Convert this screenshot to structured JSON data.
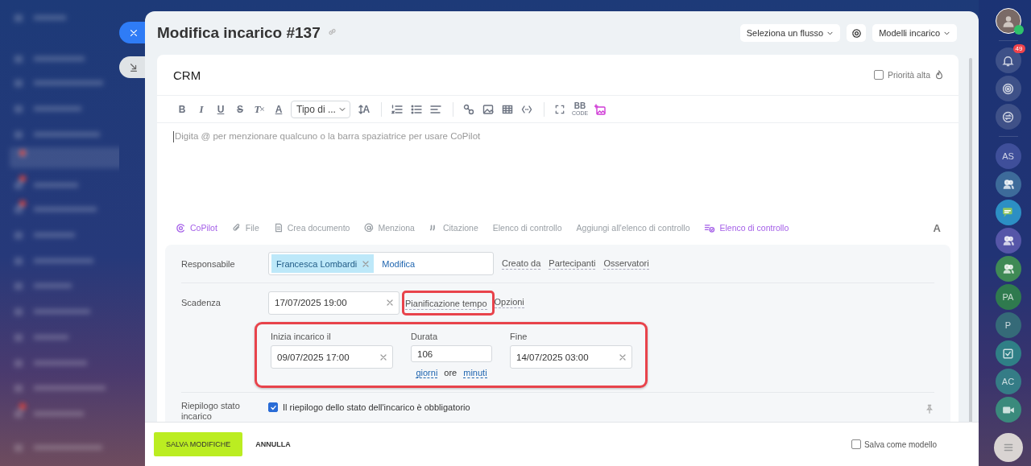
{
  "header": {
    "title": "Modifica incarico #137",
    "flow_select": "Seleziona un flusso",
    "templates_select": "Modelli incarico"
  },
  "task": {
    "title": "CRM",
    "high_priority": {
      "label": "Priorità alta",
      "checked": false
    }
  },
  "toolbar": {
    "items": [
      {
        "kind": "bold",
        "glyph": "B"
      },
      {
        "kind": "italic",
        "glyph": "I"
      },
      {
        "kind": "underline",
        "glyph": "U"
      },
      {
        "kind": "strike",
        "glyph": "S"
      },
      {
        "kind": "clear",
        "glyph": "T"
      },
      {
        "kind": "color",
        "glyph": "A"
      },
      {
        "kind": "select",
        "label": "Tipo di ..."
      },
      {
        "kind": "size",
        "glyph": "A"
      },
      {
        "kind": "sep"
      },
      {
        "kind": "ordered-list"
      },
      {
        "kind": "bullet-list"
      },
      {
        "kind": "align"
      },
      {
        "kind": "sep"
      },
      {
        "kind": "link"
      },
      {
        "kind": "image"
      },
      {
        "kind": "table"
      },
      {
        "kind": "code"
      },
      {
        "kind": "sep"
      },
      {
        "kind": "fullscreen"
      },
      {
        "kind": "bbcode",
        "glyph": "BB",
        "sub": "CODE"
      },
      {
        "kind": "ai-image"
      }
    ]
  },
  "editor": {
    "placeholder": "Digita @ per menzionare qualcuno o la barra spaziatrice per usare CoPilot"
  },
  "actions": {
    "items": [
      {
        "kind": "copilot",
        "label": "CoPilot"
      },
      {
        "kind": "file",
        "label": "File"
      },
      {
        "kind": "document",
        "label": "Crea documento"
      },
      {
        "kind": "mention",
        "label": "Menziona"
      },
      {
        "kind": "quote",
        "label": "Citazione"
      },
      {
        "kind": "plain",
        "label": "Elenco di controllo"
      },
      {
        "kind": "plain",
        "label": "Aggiungi all'elenco di controllo"
      },
      {
        "kind": "checklist",
        "label": "Elenco di controllo"
      }
    ],
    "format_toggle": "A"
  },
  "form": {
    "responsible": {
      "label": "Responsabile",
      "person": "Francesca Lombardi",
      "change_link": "Modifica",
      "role_links": [
        "Creato da",
        "Partecipanti",
        "Osservatori"
      ]
    },
    "deadline": {
      "label": "Scadenza",
      "value": "17/07/2025 19:00",
      "planning_link": "Pianificazione tempo",
      "options_link": "Opzioni"
    },
    "planning": {
      "start": {
        "label": "Inizia incarico il",
        "value": "09/07/2025 17:00"
      },
      "duration": {
        "label": "Durata",
        "value": "106"
      },
      "end": {
        "label": "Fine",
        "value": "14/07/2025 03:00"
      },
      "units": [
        {
          "label": "giorni",
          "selected": false
        },
        {
          "label": "ore",
          "selected": true
        },
        {
          "label": "minuti",
          "selected": false
        }
      ]
    },
    "summary": {
      "label": "Riepilogo stato incarico",
      "checkbox_label": "Il riepilogo dello stato dell'incarico è obbligatorio",
      "checked": true
    }
  },
  "footer": {
    "save": "SALVA MODIFICHE",
    "cancel": "ANNULLA",
    "save_template": {
      "label": "Salva come modello",
      "checked": false
    }
  },
  "right_bar": {
    "notifications": "49",
    "apps": [
      {
        "kind": "initials",
        "initials": "AS",
        "color": "#3f4f9a"
      },
      {
        "kind": "group",
        "color": "#3d6b9a"
      },
      {
        "kind": "chat",
        "color": "#2c8fc4"
      },
      {
        "kind": "group",
        "color": "#5656a8"
      },
      {
        "kind": "group",
        "color": "#3f8a55"
      },
      {
        "kind": "initials",
        "initials": "PA",
        "color": "#2f7a4e"
      },
      {
        "kind": "initials",
        "initials": "P",
        "color": "#356a78"
      },
      {
        "kind": "task",
        "color": "#2f7f86"
      },
      {
        "kind": "initials",
        "initials": "AC",
        "color": "#357c86"
      },
      {
        "kind": "video",
        "color": "#3a8a7c"
      }
    ]
  }
}
